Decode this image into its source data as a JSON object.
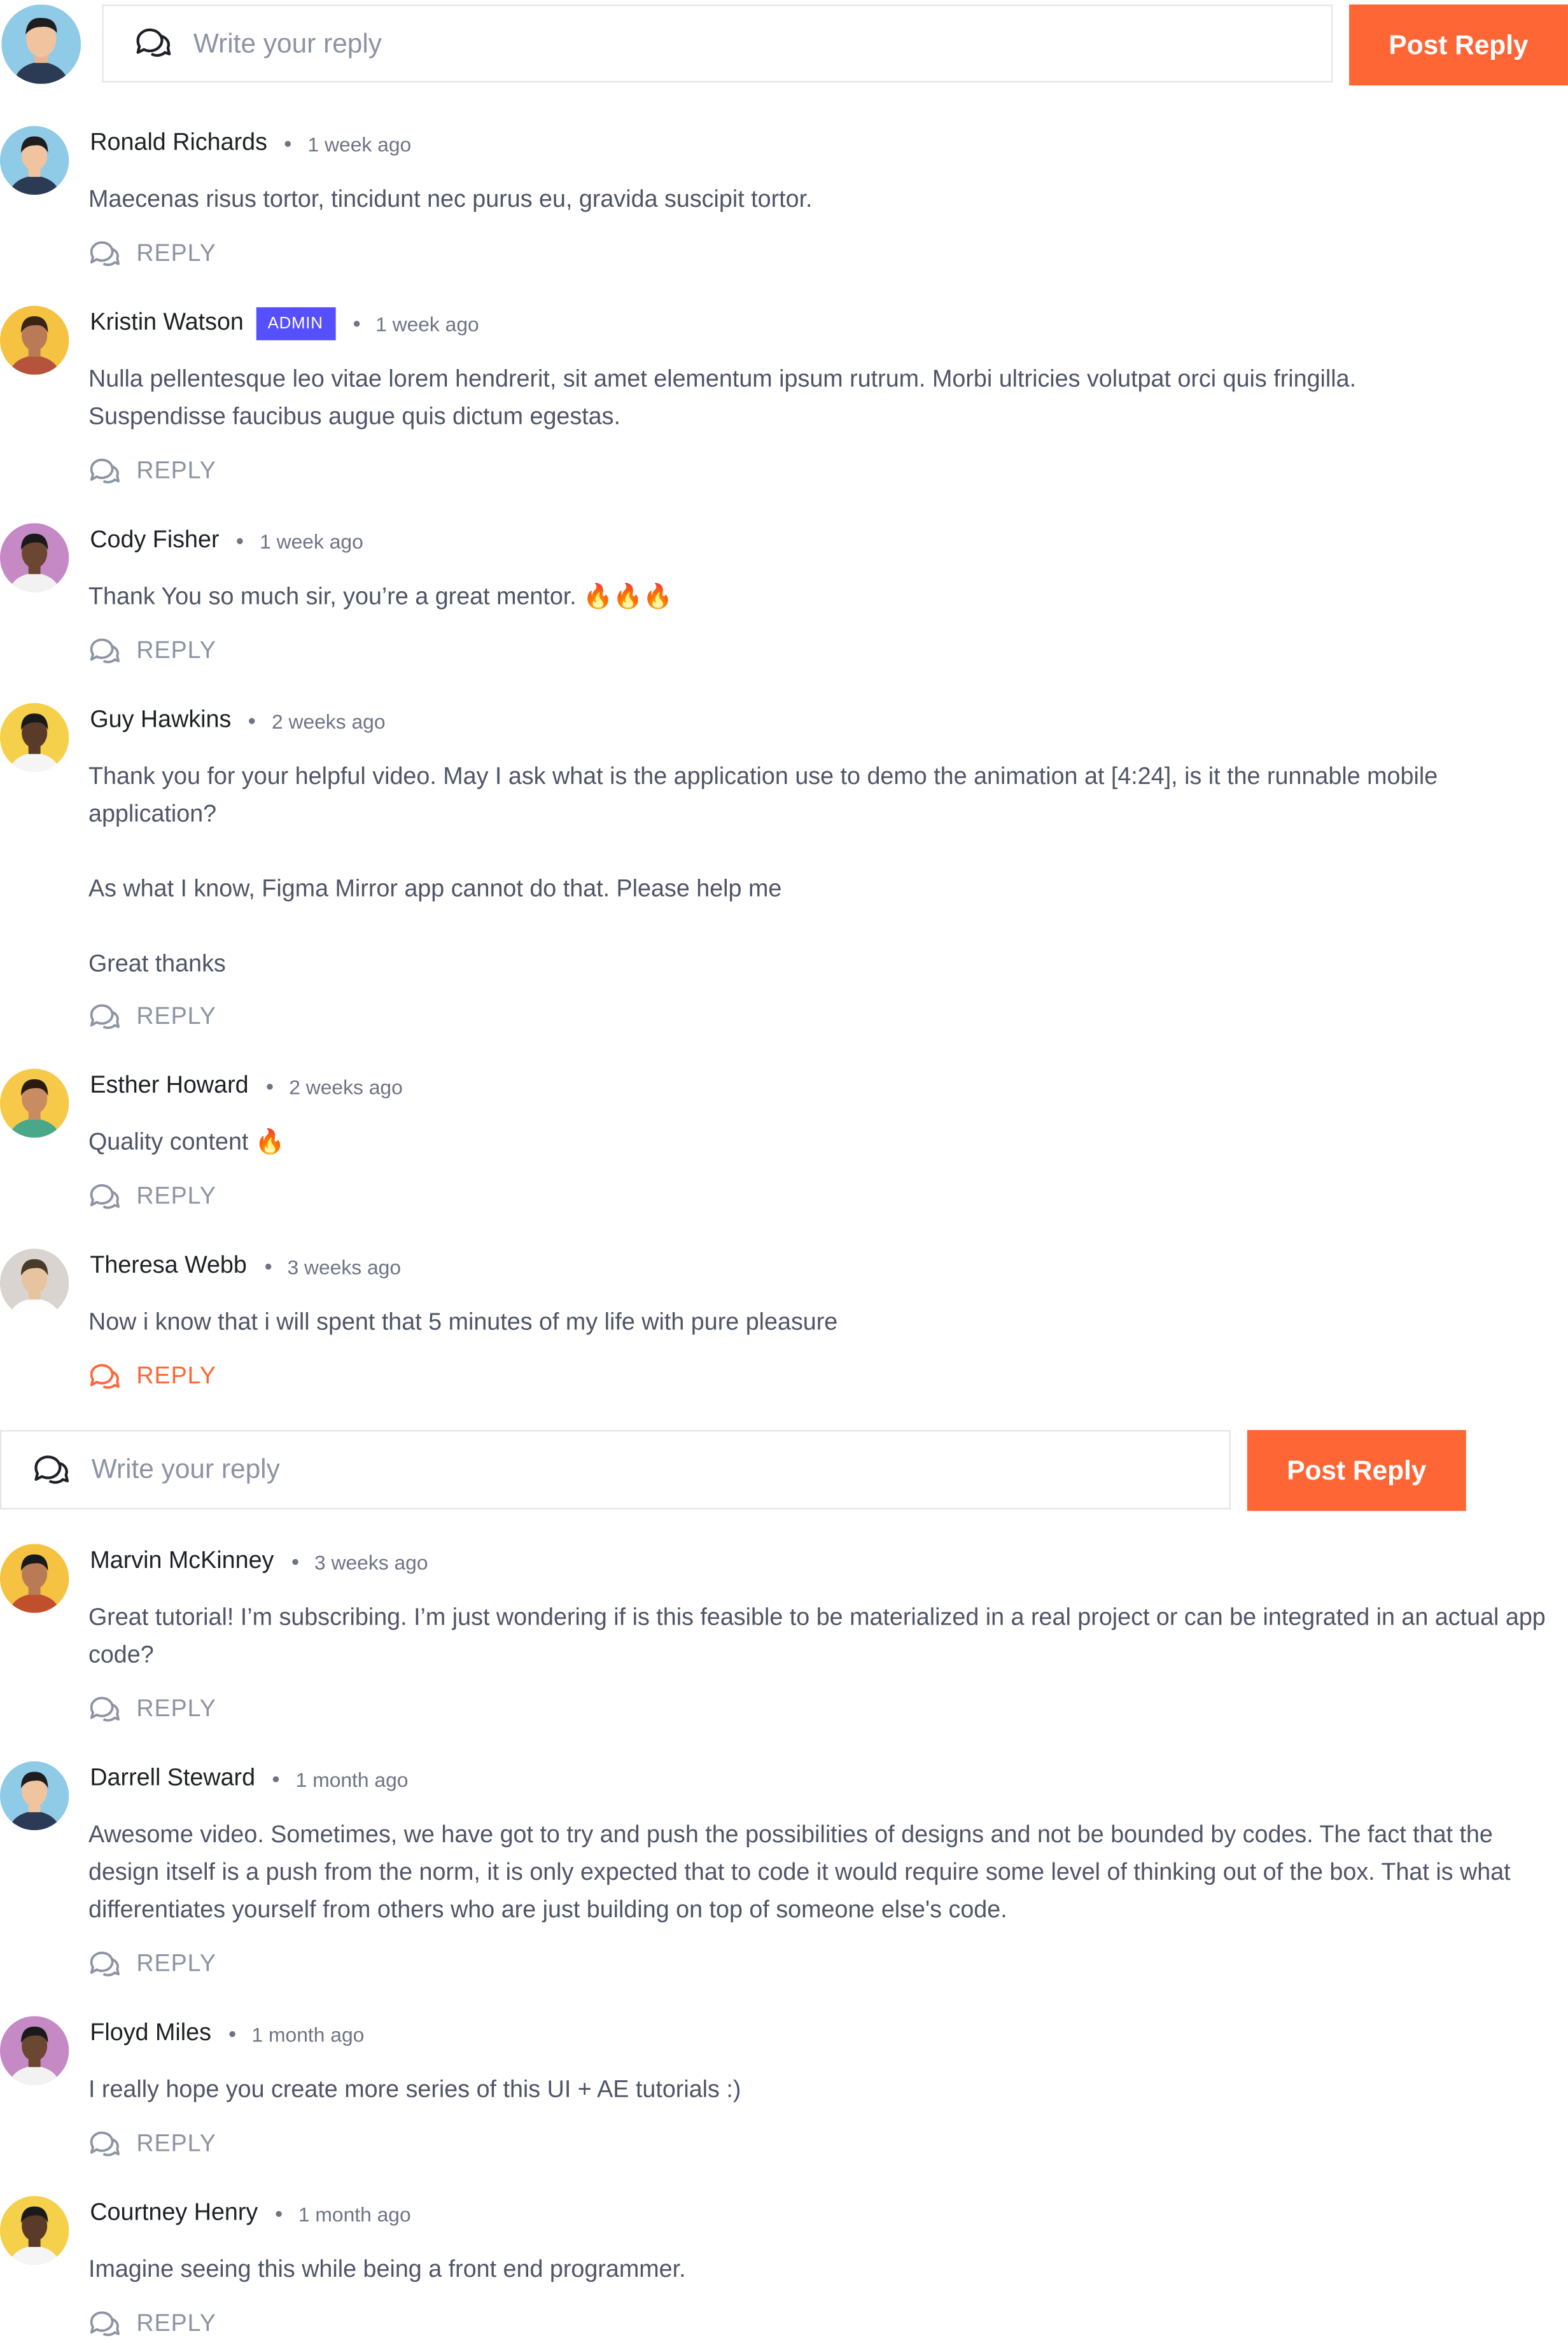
{
  "top_reply": {
    "placeholder": "Write your reply",
    "button": "Post Reply"
  },
  "inline_reply": {
    "placeholder": "Write your reply",
    "button": "Post Reply"
  },
  "reply_label": "REPLY",
  "accent_color": "#FF6636",
  "admin_badge_color": "#564FFD",
  "comments": [
    {
      "name": "Ronald Richards",
      "time": "1 week ago",
      "avatar_bg": "#8fcbe6",
      "text": "Maecenas risus tortor, tincidunt nec purus eu, gravida suscipit tortor."
    },
    {
      "name": "Kristin Watson",
      "badge": "ADMIN",
      "time": "1 week ago",
      "avatar_bg": "#f5c242",
      "text": "Nulla pellentesque leo vitae lorem hendrerit, sit amet elementum ipsum rutrum. Morbi ultricies volutpat orci quis fringilla.\nSuspendisse faucibus augue quis dictum egestas."
    },
    {
      "name": "Cody Fisher",
      "time": "1 week ago",
      "avatar_bg": "#c58ac6",
      "text": "Thank You so much sir, you’re a great mentor. 🔥🔥🔥"
    },
    {
      "name": "Guy Hawkins",
      "time": "2 weeks ago",
      "avatar_bg": "#f5d04a",
      "text": "Thank you for your helpful video. May I ask what is the application use to demo the animation at [4:24], is it the runnable mobile application?\n\nAs what I know, Figma Mirror app cannot do that. Please help me\n\nGreat thanks"
    },
    {
      "name": "Esther Howard",
      "time": "2 weeks ago",
      "avatar_bg": "#f7c948",
      "text": "Quality content 🔥"
    },
    {
      "name": "Theresa Webb",
      "time": "3 weeks ago",
      "avatar_bg": "#d9d4cf",
      "text": "Now i know that i will spent that 5 minutes of my life with pure pleasure",
      "reply_active": true
    },
    {
      "name": "Marvin McKinney",
      "time": "3 weeks ago",
      "avatar_bg": "#f5c242",
      "text": "Great tutorial! I’m subscribing. I’m just wondering if is this feasible to be materialized in a real project or can be integrated in an actual app code?"
    },
    {
      "name": "Darrell Steward",
      "time": "1 month ago",
      "avatar_bg": "#8fcbe6",
      "text": "Awesome video. Sometimes, we have got to try and push the possibilities of designs and not be bounded by codes. The fact that the design itself is a push from the norm, it is only expected that to code it would require some level of thinking out of the box. That is what differentiates yourself from others who are just building on top of someone else's code."
    },
    {
      "name": "Floyd Miles",
      "time": "1 month ago",
      "avatar_bg": "#c58ac6",
      "text": "I really hope you create more series of this UI + AE tutorials :)"
    },
    {
      "name": "Courtney Henry",
      "time": "1 month ago",
      "avatar_bg": "#f5d04a",
      "text": "Imagine seeing this while being a front end programmer."
    }
  ]
}
